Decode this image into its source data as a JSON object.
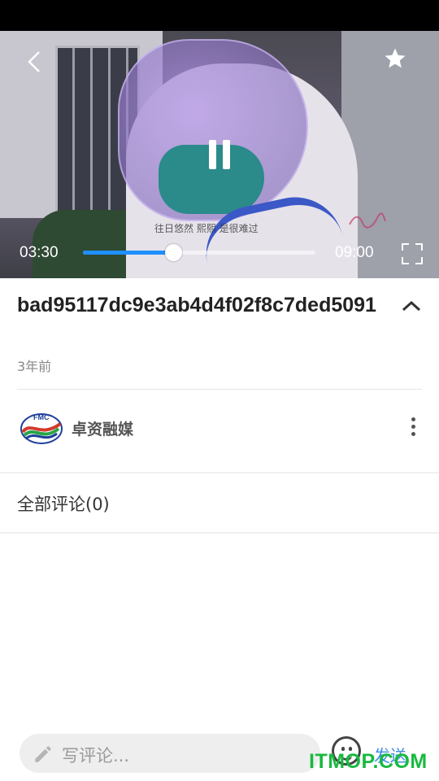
{
  "player": {
    "current_time": "03:30",
    "duration": "09:00",
    "progress_fraction": 0.389,
    "subtitle": "往日悠然 熙熙 是很难过",
    "accent_color": "#1e90ff",
    "icons": {
      "back": "chevron-left-icon",
      "favorite": "star-icon",
      "pause": "pause-icon",
      "fullscreen": "fullscreen-icon"
    }
  },
  "video_info": {
    "title": "bad95117dc9e3ab4d4f02f8c7ded5091",
    "posted": "3年前"
  },
  "channel": {
    "logo_text": "FMC",
    "name": "卓资融媒"
  },
  "comments": {
    "header": "全部评论(0)"
  },
  "composer": {
    "placeholder": "写评论...",
    "send_label": "发送"
  },
  "watermark": {
    "text": "ITMOP.COM"
  }
}
